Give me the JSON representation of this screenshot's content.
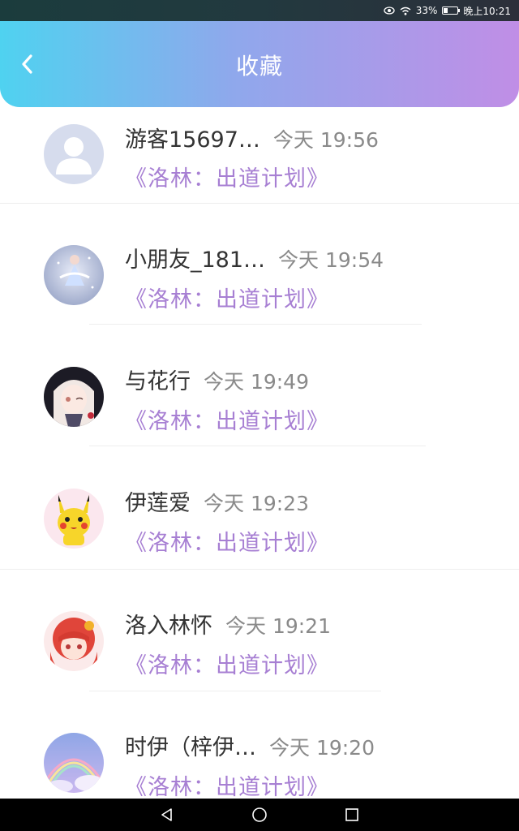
{
  "status_bar": {
    "battery": "33%",
    "time": "晚上10:21",
    "icons": [
      "eye-icon",
      "wifi-icon",
      "battery-icon"
    ]
  },
  "header": {
    "title": "收藏",
    "back_icon": "chevron-left-icon"
  },
  "items": [
    {
      "name": "游客15697…",
      "time": "今天 19:56",
      "book": "《洛林：出道计划》",
      "avatar": "default-avatar"
    },
    {
      "name": "小朋友_181…",
      "time": "今天 19:54",
      "book": "《洛林：出道计划》",
      "avatar": "dancer-avatar"
    },
    {
      "name": "与花行",
      "time": "今天 19:49",
      "book": "《洛林：出道计划》",
      "avatar": "anime-girl-avatar"
    },
    {
      "name": "伊莲爱",
      "time": "今天 19:23",
      "book": "《洛林：出道计划》",
      "avatar": "pikachu-avatar"
    },
    {
      "name": "洛入林怀",
      "time": "今天 19:21",
      "book": "《洛林：出道计划》",
      "avatar": "red-hair-avatar"
    },
    {
      "name": "时伊（梓伊…",
      "time": "今天 19:20",
      "book": "《洛林：出道计划》",
      "avatar": "rainbow-avatar"
    }
  ],
  "colors": {
    "header_start": "#4fd2f0",
    "header_end": "#c08ee6",
    "book_title": "#a77fd3",
    "time_text": "#8a8a8a"
  }
}
